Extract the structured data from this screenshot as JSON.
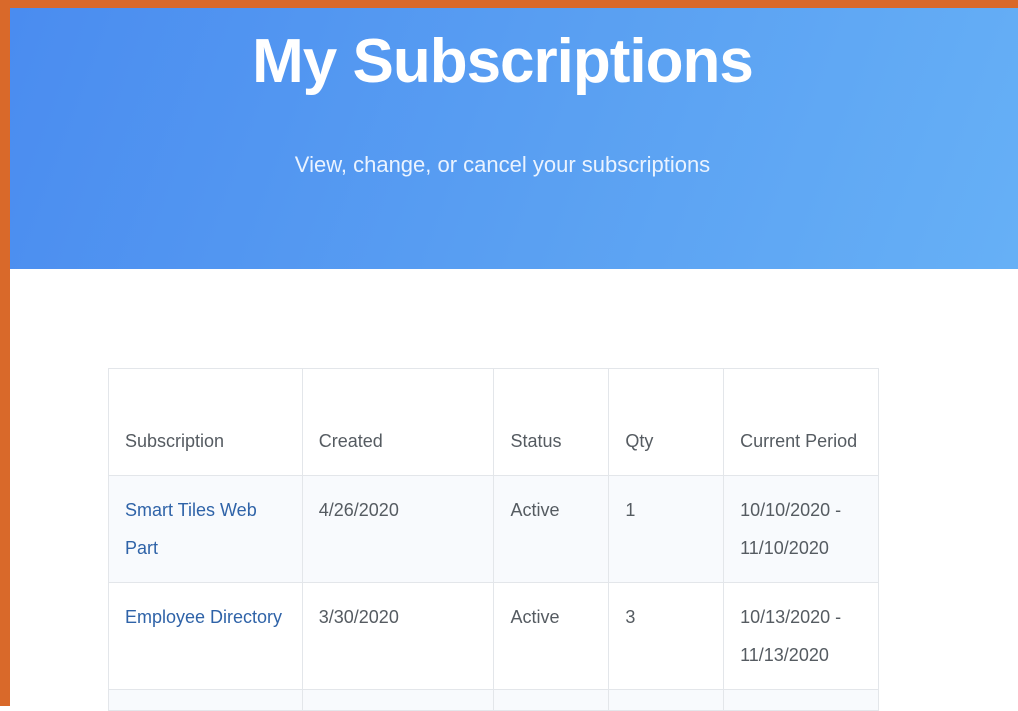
{
  "header": {
    "title": "My Subscriptions",
    "subtitle": "View, change, or cancel your subscriptions"
  },
  "colors": {
    "accent_frame": "#d9692a",
    "hero_gradient_start": "#4a8cf0",
    "hero_gradient_end": "#66b0f6",
    "link": "#2f63a8"
  },
  "table": {
    "columns": [
      "Subscription",
      "Created",
      "Status",
      "Qty",
      "Current Period"
    ],
    "rows": [
      {
        "subscription": "Smart Tiles Web Part",
        "created": "4/26/2020",
        "status": "Active",
        "qty": "1",
        "period": "10/10/2020 - 11/10/2020"
      },
      {
        "subscription": "Employee Directory",
        "created": "3/30/2020",
        "status": "Active",
        "qty": "3",
        "period": "10/13/2020 - 11/13/2020"
      }
    ]
  }
}
